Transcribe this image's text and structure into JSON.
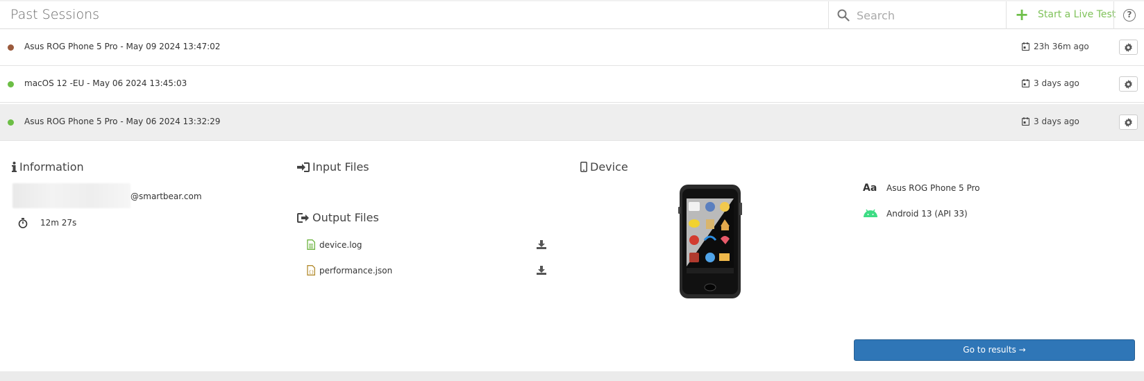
{
  "header": {
    "title": "Past Sessions",
    "search_placeholder": "Search",
    "live_test_label": "Start a Live Test",
    "help_label": "?"
  },
  "sessions": [
    {
      "name": "Asus ROG Phone 5 Pro - May 09 2024 13:47:02",
      "time": "23h 36m ago",
      "status_color": "#9b5a3c"
    },
    {
      "name": "macOS 12 -EU - May 06 2024 13:45:03",
      "time": "3 days ago",
      "status_color": "#6cbe45"
    },
    {
      "name": "Asus ROG Phone 5 Pro - May 06 2024 13:32:29",
      "time": "3 days ago",
      "status_color": "#6cbe45"
    }
  ],
  "details": {
    "information_title": "Information",
    "email_domain": "@smartbear.com",
    "duration": "12m 27s",
    "input_files_title": "Input Files",
    "output_files_title": "Output Files",
    "output_files": [
      {
        "name": "device.log",
        "icon": "log-file-icon"
      },
      {
        "name": "performance.json",
        "icon": "json-file-icon"
      }
    ],
    "device_title": "Device",
    "device_name": "Asus ROG Phone 5 Pro",
    "device_os": "Android 13 (API 33)",
    "results_button": "Go to results →"
  },
  "colors": {
    "accent_green": "#7fc25a",
    "primary_blue": "#2f76b7",
    "active_row_bg": "#eeeeee"
  }
}
